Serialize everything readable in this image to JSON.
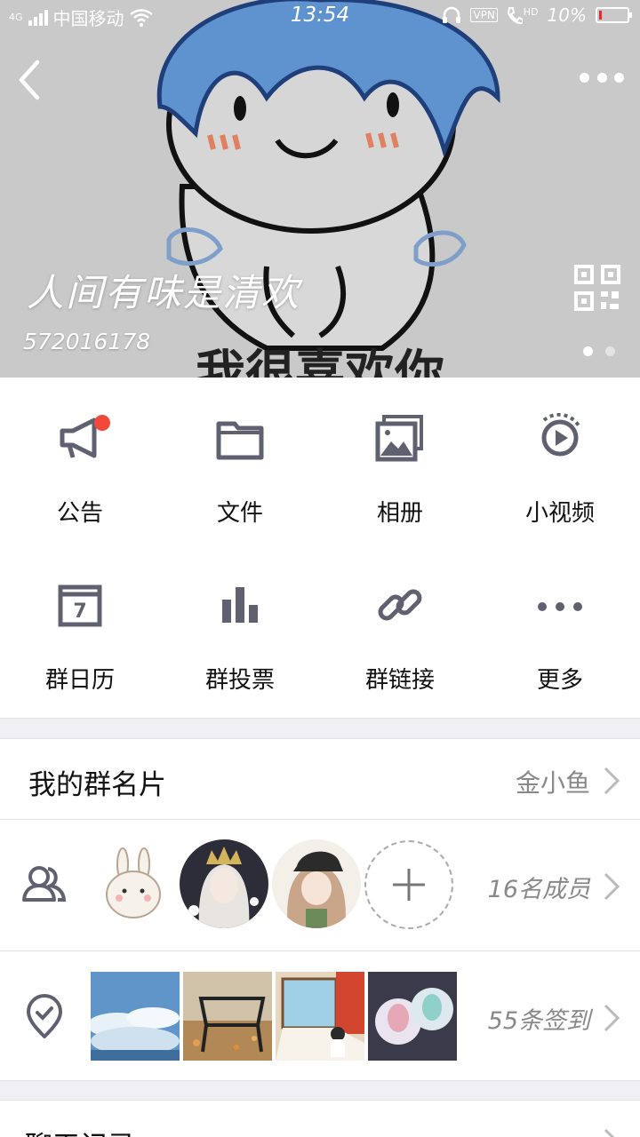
{
  "status_bar": {
    "network": "4G",
    "carrier": "中国移动",
    "time": "13:54",
    "vpn": "VPN",
    "hd": "HD",
    "battery_text": "10%",
    "battery_level": 0.1,
    "icons": [
      "signal-icon",
      "wifi-icon",
      "headset-icon",
      "call-hd-icon",
      "battery-icon"
    ]
  },
  "header": {
    "group_name": "人间有味是清欢",
    "group_id": "572016178",
    "cover_caption": "我很喜欢你",
    "carousel": {
      "pages": 2,
      "active": 1
    }
  },
  "colors": {
    "icon_gray": "#5f6170",
    "notice_dot": "#f2493c",
    "secondary_text": "#888888",
    "divider": "#e2e2e6",
    "section_bg": "#efeff4"
  },
  "features": [
    {
      "label": "公告",
      "icon": "megaphone-icon",
      "has_badge": true
    },
    {
      "label": "文件",
      "icon": "folder-icon"
    },
    {
      "label": "相册",
      "icon": "photo-album-icon"
    },
    {
      "label": "小视频",
      "icon": "video-play-icon"
    },
    {
      "label": "群日历",
      "icon": "calendar-icon",
      "calendar_day": "7"
    },
    {
      "label": "群投票",
      "icon": "bar-chart-icon"
    },
    {
      "label": "群链接",
      "icon": "link-icon"
    },
    {
      "label": "更多",
      "icon": "more-dots-icon"
    }
  ],
  "card": {
    "title": "我的群名片",
    "value": "金小鱼"
  },
  "members": {
    "count_text": "16名成员",
    "icon": "members-icon",
    "add_icon": "plus-icon"
  },
  "signin": {
    "count_text": "55条签到",
    "icon": "location-check-icon"
  },
  "chat": {
    "title": "聊天记录"
  }
}
